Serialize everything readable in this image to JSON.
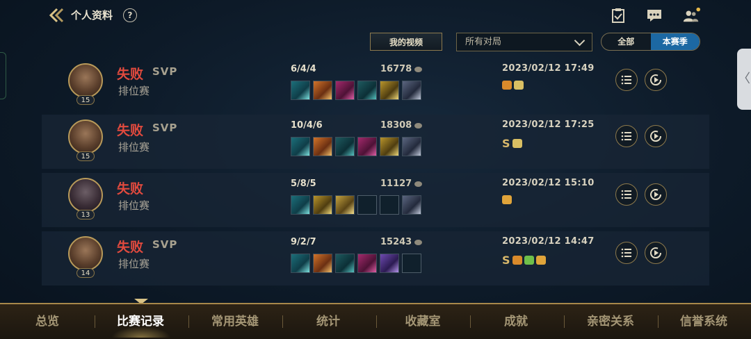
{
  "header": {
    "title": "个人资料",
    "help_label": "?"
  },
  "filters": {
    "video_button": "我的视频",
    "match_select": "所有对局",
    "season_toggle": {
      "all_label": "全部",
      "season_label": "本赛季",
      "selected": "本赛季"
    }
  },
  "matches": [
    {
      "result": "失败",
      "svp": "SVP",
      "mode": "排位赛",
      "level": "15",
      "kda": "6/4/4",
      "gold": "16778",
      "time": "2023/02/12 17:49",
      "items": [
        "teal",
        "orange",
        "magenta",
        "teal2",
        "gold",
        "spirit"
      ],
      "badges": [
        "wing-badge-icon",
        "coins-badge-icon"
      ],
      "s_rank": ""
    },
    {
      "result": "失败",
      "svp": "SVP",
      "mode": "排位赛",
      "level": "15",
      "kda": "10/4/6",
      "gold": "18308",
      "time": "2023/02/12 17:25",
      "items": [
        "teal",
        "orange",
        "teal2",
        "magenta",
        "gold",
        "spirit"
      ],
      "badges": [
        "coins-badge-icon"
      ],
      "s_rank": "S"
    },
    {
      "result": "失败",
      "svp": "",
      "mode": "排位赛",
      "level": "13",
      "kda": "5/8/5",
      "gold": "11127",
      "time": "2023/02/12 15:10",
      "items": [
        "teal",
        "gold",
        "gold2",
        "empty",
        "empty",
        "spirit"
      ],
      "badges": [
        "drop-badge-icon"
      ],
      "s_rank": ""
    },
    {
      "result": "失败",
      "svp": "SVP",
      "mode": "排位赛",
      "level": "14",
      "kda": "9/2/7",
      "gold": "15243",
      "time": "2023/02/12 14:47",
      "items": [
        "teal",
        "orange",
        "teal2",
        "magenta",
        "purple",
        "empty"
      ],
      "badges": [
        "wing-badge-icon",
        "flag-badge-icon",
        "drop-badge-icon"
      ],
      "s_rank": "S"
    }
  ],
  "bottom_nav": {
    "items": [
      "总览",
      "比赛记录",
      "常用英雄",
      "统计",
      "收藏室",
      "成就",
      "亲密关系",
      "信誉系统"
    ],
    "active": "比赛记录"
  },
  "colors": {
    "defeat": "#e14a3e",
    "accent_blue": "#1c68a3",
    "gold_border": "#8e7a4c"
  }
}
